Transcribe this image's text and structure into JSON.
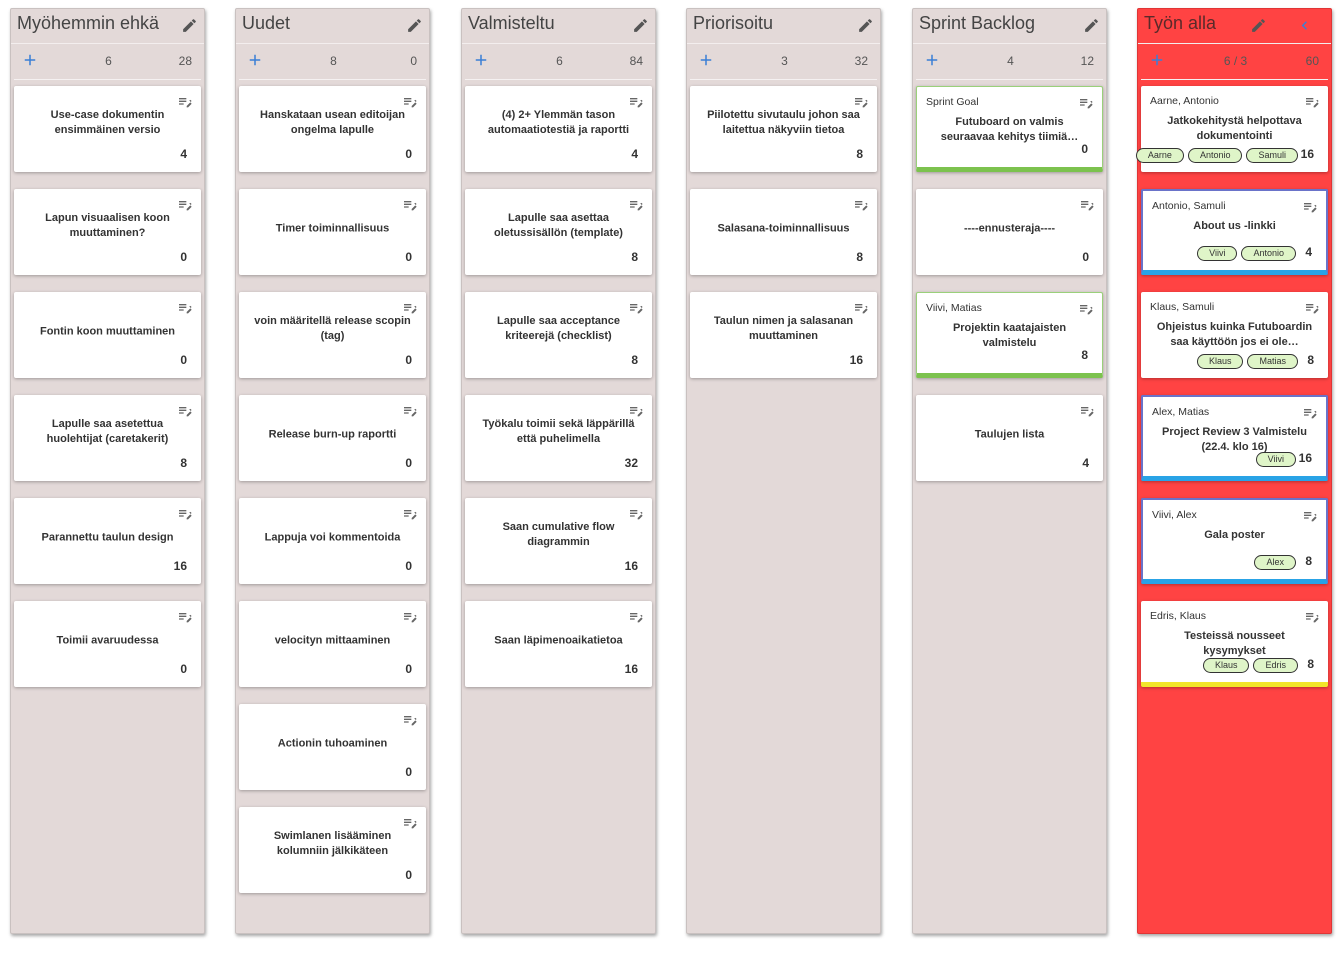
{
  "icons": {
    "edit": "pencil-icon",
    "add": "plus-icon",
    "card_edit": "notes-edit-icon",
    "collapse": "chevron-left-icon"
  },
  "colors": {
    "column_bg": "#e3d9d8",
    "wip_column_bg": "#ff4343",
    "accent_blue": "#3a7fd6",
    "tag_bg": "#dff5c8",
    "green_stripe": "#7cc24e",
    "blue_stripe": "#29a3e6",
    "yellow_stripe": "#f2e62a"
  },
  "columns": [
    {
      "title": "Myöhemmin ehkä",
      "count": "6",
      "points": "28",
      "cards": [
        {
          "title": "Use-case dokumentin ensimmäinen versio",
          "points": "4"
        },
        {
          "title": "Lapun visuaalisen koon muuttaminen?",
          "points": "0"
        },
        {
          "title": "Fontin koon muuttaminen",
          "points": "0"
        },
        {
          "title": "Lapulle saa asetettua huolehtijat (caretakerit)",
          "points": "8"
        },
        {
          "title": "Parannettu taulun design",
          "points": "16"
        },
        {
          "title": "Toimii avaruudessa",
          "points": "0"
        }
      ]
    },
    {
      "title": "Uudet",
      "count": "8",
      "points": "0",
      "cards": [
        {
          "title": "Hanskataan usean editoijan ongelma lapulle",
          "points": "0"
        },
        {
          "title": "Timer toiminnallisuus",
          "points": "0"
        },
        {
          "title": "voin määritellä release scopin (tag)",
          "points": "0"
        },
        {
          "title": "Release burn-up raportti",
          "points": "0"
        },
        {
          "title": "Lappuja voi kommentoida",
          "points": "0"
        },
        {
          "title": "velocityn mittaaminen",
          "points": "0"
        },
        {
          "title": "Actionin tuhoaminen",
          "points": "0"
        },
        {
          "title": "Swimlanen lisääminen kolumniin jälkikäteen",
          "points": "0"
        }
      ]
    },
    {
      "title": "Valmisteltu",
      "count": "6",
      "points": "84",
      "cards": [
        {
          "title": "(4) 2+ Ylemmän tason automaatiotestiä ja raportti",
          "points": "4"
        },
        {
          "title": "Lapulle saa asettaa oletussisällön (template)",
          "points": "8"
        },
        {
          "title": "Lapulle saa acceptance kriteerejä (checklist)",
          "points": "8"
        },
        {
          "title": "Työkalu toimii sekä läppärillä että puhelimella",
          "points": "32"
        },
        {
          "title": "Saan cumulative flow diagrammin",
          "points": "16"
        },
        {
          "title": "Saan läpimenoaikatietoa",
          "points": "16"
        }
      ]
    },
    {
      "title": "Priorisoitu",
      "count": "3",
      "points": "32",
      "cards": [
        {
          "title": "Piilotettu sivutaulu johon saa laitettua näkyviin tietoa",
          "points": "8"
        },
        {
          "title": "Salasana-toiminnallisuus",
          "points": "8"
        },
        {
          "title": "Taulun nimen ja salasanan muuttaminen",
          "points": "16"
        }
      ]
    },
    {
      "title": "Sprint Backlog",
      "count": "4",
      "points": "12",
      "cards": [
        {
          "owners": "Sprint Goal",
          "title": "Futuboard on valmis seuraavaa kehitys tiimiä…",
          "points": "0",
          "style": "green"
        },
        {
          "title": "----ennusteraja----",
          "points": "0"
        },
        {
          "owners": "Viivi, Matias",
          "title": "Projektin kaatajaisten valmistelu",
          "points": "8",
          "style": "green"
        },
        {
          "title": "Taulujen lista",
          "points": "4"
        }
      ]
    },
    {
      "title": "Työn alla",
      "count": "6 / 3",
      "points": "60",
      "wip": true,
      "cards": [
        {
          "owners": "Aarne, Antonio",
          "title": "Jatkokehitystä helpottava dokumentointi",
          "points": "16",
          "tags": [
            "Aarne",
            "Antonio",
            "Samuli"
          ]
        },
        {
          "owners": "Antonio, Samuli",
          "title": "About us -linkki",
          "points": "4",
          "tags": [
            "Viivi",
            "Antonio"
          ],
          "style": "blue"
        },
        {
          "owners": "Klaus, Samuli",
          "title": "Ohjeistus kuinka Futuboardin saa käyttöön jos ei ole…",
          "points": "8",
          "tags": [
            "Klaus",
            "Matias"
          ]
        },
        {
          "owners": "Alex, Matias",
          "title": "Project Review 3 Valmistelu (22.4. klo 16)",
          "points": "16",
          "tags": [
            "Viivi"
          ],
          "style": "blue"
        },
        {
          "owners": "Viivi, Alex",
          "title": "Gala poster",
          "points": "8",
          "tags": [
            "Alex"
          ],
          "style": "blue"
        },
        {
          "owners": "Edris, Klaus",
          "title": "Testeissä nousseet kysymykset",
          "points": "8",
          "tags": [
            "Klaus",
            "Edris"
          ],
          "style": "yellow"
        }
      ]
    }
  ]
}
